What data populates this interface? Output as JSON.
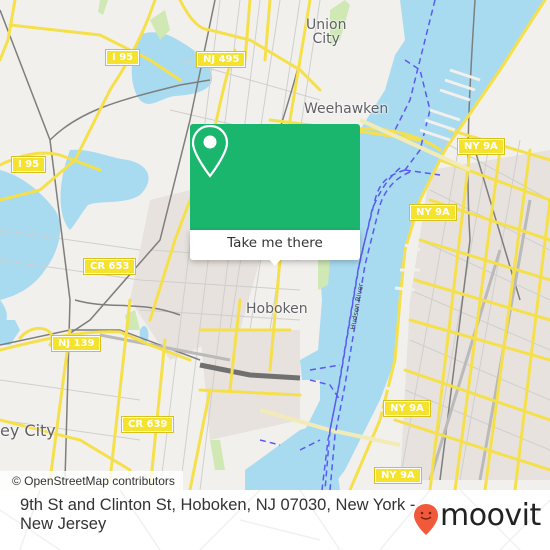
{
  "map": {
    "colors": {
      "land": "#f2f0ec",
      "water": "#a9dbf0",
      "park": "#cfe8b4",
      "major_road": "#f7e552",
      "road_casing": "#e7cf3a",
      "minor_road": "#c9c9c9",
      "rail": "#808080",
      "ferry": "#6060f0",
      "urban": "#e6e1dc"
    },
    "place_labels": [
      {
        "id": "union-city",
        "text": "Union\nCity"
      },
      {
        "id": "weehawken",
        "text": "Weehawken"
      },
      {
        "id": "hoboken",
        "text": "Hoboken"
      },
      {
        "id": "jersey-city",
        "text": "ey City"
      }
    ],
    "river_label": "Hudson River",
    "road_shields": [
      {
        "id": "i95-top",
        "text": "I 95"
      },
      {
        "id": "nj495",
        "text": "NJ 495"
      },
      {
        "id": "i95-left",
        "text": "I 95"
      },
      {
        "id": "ny9a-top",
        "text": "NY 9A"
      },
      {
        "id": "ny9a-mid",
        "text": "NY 9A"
      },
      {
        "id": "cr653",
        "text": "CR 653"
      },
      {
        "id": "nj139",
        "text": "NJ 139"
      },
      {
        "id": "ny9a-lower",
        "text": "NY 9A"
      },
      {
        "id": "cr639",
        "text": "CR 639"
      },
      {
        "id": "ny9a-bottom",
        "text": "NY 9A"
      }
    ],
    "attribution": "© OpenStreetMap contributors"
  },
  "popup": {
    "icon": "location-pin-icon",
    "button_label": "Take me there",
    "color": "#1bb66e"
  },
  "footer": {
    "address": "9th St and Clinton St, Hoboken, NJ 07030, New York - New Jersey",
    "logo_text": "moovit",
    "logo_icon": "moovit-pin-icon",
    "logo_color": "#f05a3a"
  }
}
